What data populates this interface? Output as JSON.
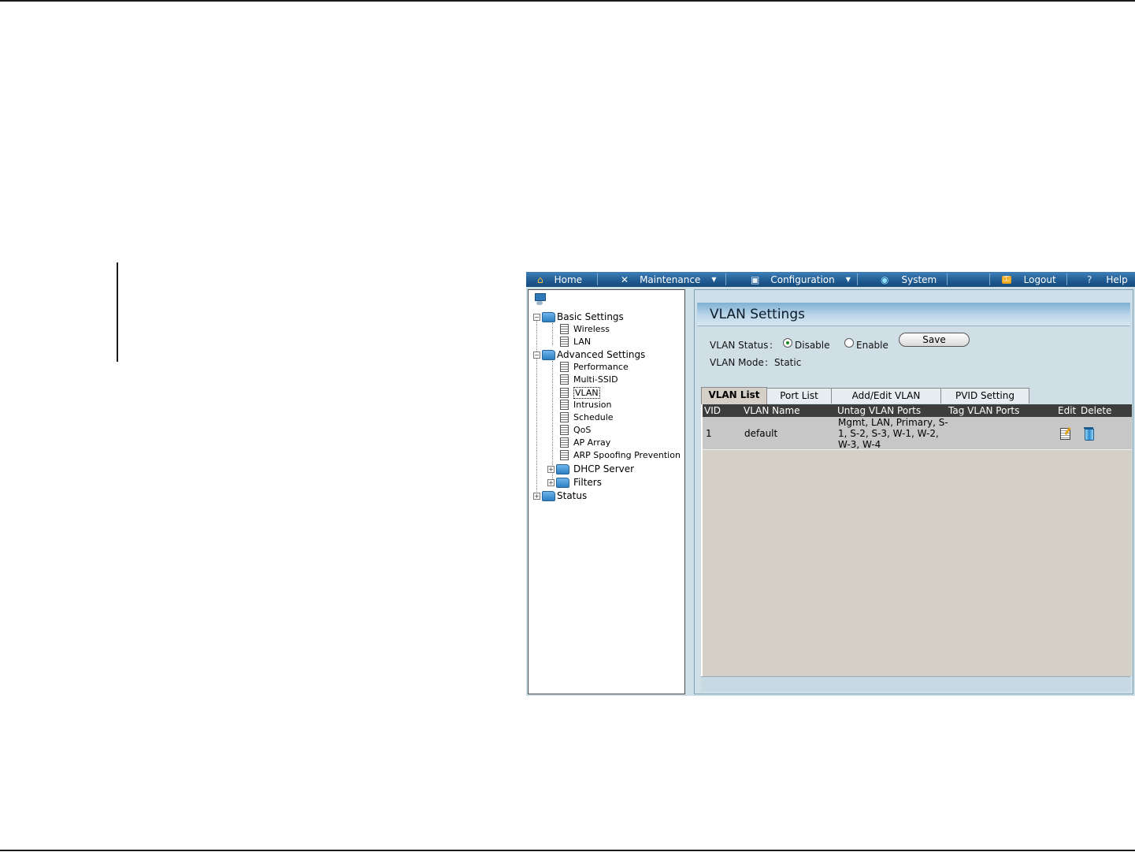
{
  "nav": {
    "home": "Home",
    "maintenance": "Maintenance",
    "configuration": "Configuration",
    "system": "System",
    "logout": "Logout",
    "help": "Help"
  },
  "tree": {
    "basic_settings": "Basic Settings",
    "wireless": "Wireless",
    "lan": "LAN",
    "advanced_settings": "Advanced Settings",
    "performance": "Performance",
    "multi_ssid": "Multi-SSID",
    "vlan": "VLAN",
    "intrusion": "Intrusion",
    "schedule": "Schedule",
    "qos": "QoS",
    "ap_array": "AP Array",
    "arp_spoofing": "ARP Spoofing Prevention",
    "dhcp_server": "DHCP Server",
    "filters": "Filters",
    "status": "Status"
  },
  "panel": {
    "title": "VLAN Settings",
    "vlan_status_label": "VLAN Status",
    "colon": ":",
    "disable_label": "Disable",
    "enable_label": "Enable",
    "vlan_status_value": "Disable",
    "save_label": "Save",
    "vlan_mode_label": "VLAN Mode",
    "vlan_mode_value": "Static"
  },
  "tabs": [
    "VLAN List",
    "Port List",
    "Add/Edit VLAN",
    "PVID Setting"
  ],
  "table": {
    "headers": [
      "VID",
      "VLAN Name",
      "Untag VLAN Ports",
      "Tag VLAN Ports",
      "Edit",
      "Delete"
    ],
    "rows": [
      {
        "vid": "1",
        "name": "default",
        "untag_ports": "Mgmt, LAN, Primary, S-1, S-2, S-3, W-1, W-2, W-3, W-4",
        "tag_ports": ""
      }
    ]
  },
  "icons": {
    "home": "home-icon",
    "maintenance": "tools-icon",
    "configuration": "disk-icon",
    "system": "globe-icon",
    "logout": "key-icon",
    "help": "help-icon",
    "edit": "edit-icon",
    "delete": "trash-icon"
  }
}
